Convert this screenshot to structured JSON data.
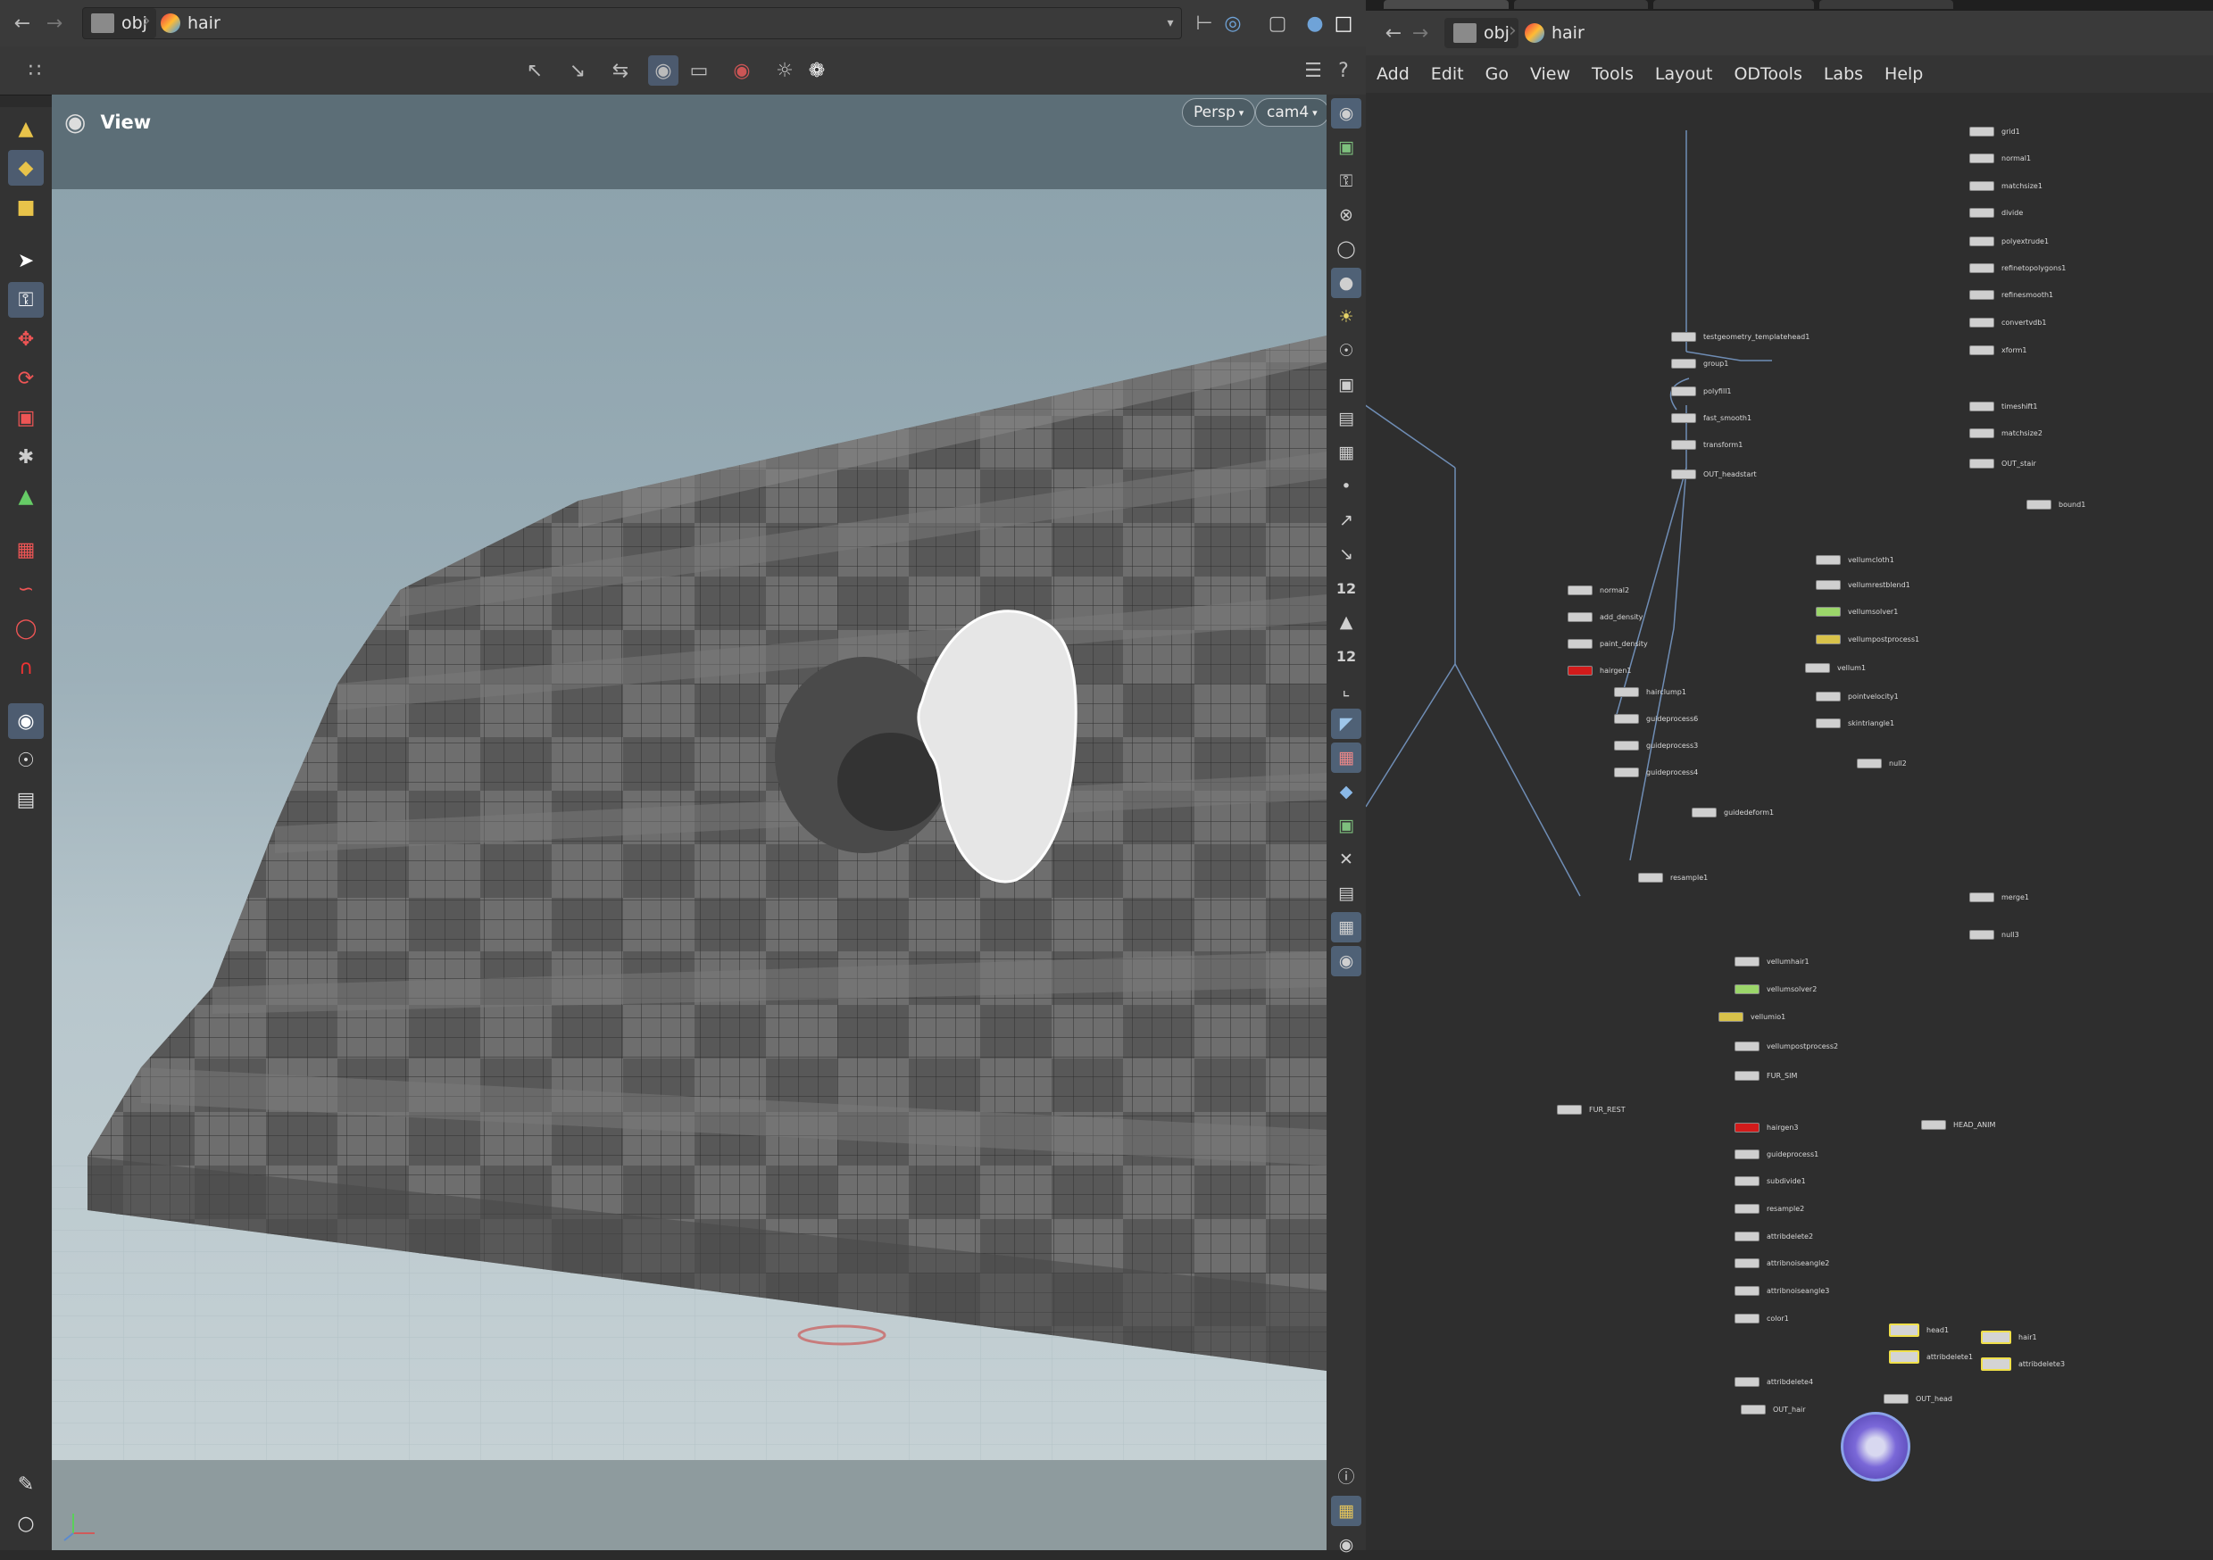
{
  "left_pane": {
    "path": {
      "root": "obj",
      "current": "hair"
    },
    "viewport": {
      "title": "View",
      "projection": "Persp",
      "camera": "cam4"
    }
  },
  "right_pane": {
    "path": {
      "root": "obj",
      "current": "hair"
    },
    "menu": [
      "Add",
      "Edit",
      "Go",
      "View",
      "Tools",
      "Layout",
      "ODTools",
      "Labs",
      "Help"
    ]
  },
  "right_toolbar": {
    "badge_1": "12",
    "badge_2": "12"
  },
  "network_nodes": [
    {
      "label": "grid1"
    },
    {
      "label": "normal1"
    },
    {
      "label": "matchsize1"
    },
    {
      "label": "divide"
    },
    {
      "label": "polyextrude1"
    },
    {
      "label": "refinetopolygons1"
    },
    {
      "label": "refinesmooth1"
    },
    {
      "label": "convertvdb1"
    },
    {
      "label": "xform1"
    },
    {
      "label": "timeshift1"
    },
    {
      "label": "matchsize2"
    },
    {
      "label": "OUT_stair"
    },
    {
      "label": "bound1"
    },
    {
      "label": "testgeometry_templatehead1"
    },
    {
      "label": "group1"
    },
    {
      "label": "polyfill1"
    },
    {
      "label": "fast_smooth1"
    },
    {
      "label": "transform1"
    },
    {
      "label": "OUT_headstart"
    },
    {
      "label": "vellumcloth1"
    },
    {
      "label": "vellumrestblend1"
    },
    {
      "label": "vellumsolver1"
    },
    {
      "label": "vellumpostprocess1"
    },
    {
      "label": "vellum1"
    },
    {
      "label": "pointvelocity1"
    },
    {
      "label": "skintriangle1"
    },
    {
      "label": "null2"
    },
    {
      "label": "normal2"
    },
    {
      "label": "add_density"
    },
    {
      "label": "paint_density"
    },
    {
      "label": "hairgen1"
    },
    {
      "label": "hairclump1"
    },
    {
      "label": "guideprocess6"
    },
    {
      "label": "guideprocess3"
    },
    {
      "label": "guideprocess4"
    },
    {
      "label": "guidedeform1"
    },
    {
      "label": "resample1"
    },
    {
      "label": "merge1"
    },
    {
      "label": "null3"
    },
    {
      "label": "vellumhair1"
    },
    {
      "label": "vellumsolver2"
    },
    {
      "label": "vellumio1"
    },
    {
      "label": "vellumpostprocess2"
    },
    {
      "label": "FUR_SIM"
    },
    {
      "label": "FUR_REST"
    },
    {
      "label": "hairgen3"
    },
    {
      "label": "HEAD_ANIM"
    },
    {
      "label": "guideprocess1"
    },
    {
      "label": "subdivide1"
    },
    {
      "label": "resample2"
    },
    {
      "label": "attribdelete2"
    },
    {
      "label": "attribnoiseangle2"
    },
    {
      "label": "attribnoiseangle3"
    },
    {
      "label": "color1"
    },
    {
      "label": "attribdelete4"
    },
    {
      "label": "OUT_hair"
    },
    {
      "label": "head1"
    },
    {
      "label": "attribdelete1"
    },
    {
      "label": "OUT_head"
    },
    {
      "label": "hair1"
    },
    {
      "label": "attribdelete3"
    }
  ]
}
